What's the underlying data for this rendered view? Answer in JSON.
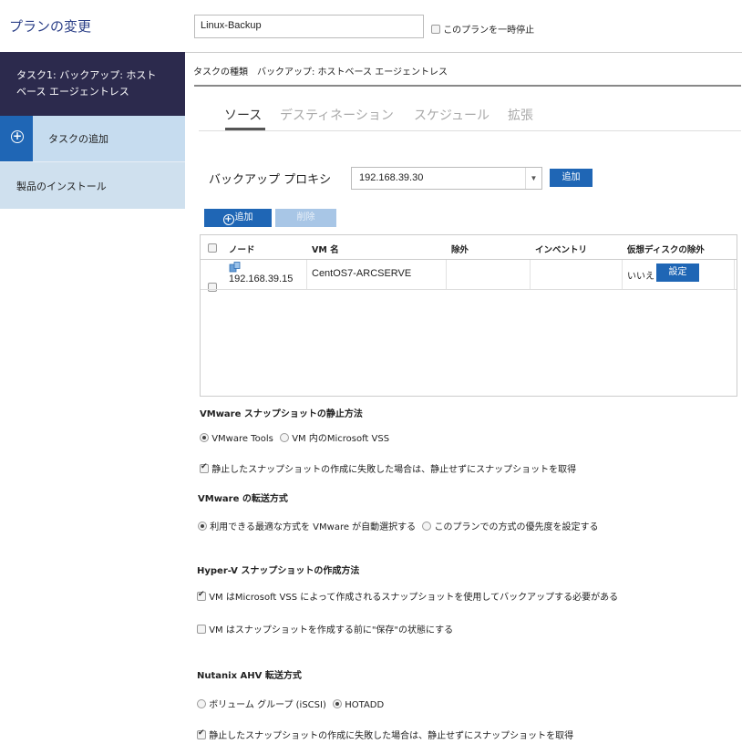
{
  "sidebar": {
    "title": "プランの変更",
    "task1_line1": "タスク1: バックアップ: ホスト",
    "task1_line2": "ベース エージェントレス",
    "add_task": "タスクの追加",
    "install": "製品のインストール"
  },
  "header": {
    "plan_name": "Linux-Backup",
    "suspend_label": "このプランを一時停止",
    "task_type": "タスクの種類　バックアップ: ホストベース エージェントレス"
  },
  "tabs": [
    "ソース",
    "デスティネーション",
    "スケジュール",
    "拡張"
  ],
  "source": {
    "proxy_label": "バックアップ プロキシ",
    "proxy_value": "192.168.39.30",
    "proxy_add": "追加",
    "add_button": "追加",
    "delete_button": "削除",
    "columns": [
      "ノード",
      "VM 名",
      "除外",
      "インベントリ",
      "仮想ディスクの除外"
    ],
    "rows": [
      {
        "node": "192.168.39.15",
        "vm": "CentOS7-ARCSERVE",
        "exclude": "",
        "inventory": "",
        "disk_exclude": "いいえ",
        "setting": "設定"
      }
    ]
  },
  "vmware_snapshot": {
    "title": "VMware スナップショットの静止方法",
    "opt1": "VMware Tools",
    "opt2": "VM 内のMicrosoft VSS",
    "fallback": "静止したスナップショットの作成に失敗した場合は、静止せずにスナップショットを取得"
  },
  "vmware_transfer": {
    "title": "VMware の転送方式",
    "opt1": "利用できる最適な方式を VMware が自動選択する",
    "opt2": "このプランでの方式の優先度を設定する"
  },
  "hyperv": {
    "title": "Hyper-V スナップショットの作成方法",
    "opt1": "VM はMicrosoft VSS によって作成されるスナップショットを使用してバックアップする必要がある",
    "opt2": "VM はスナップショットを作成する前に\"保存\"の状態にする"
  },
  "nutanix": {
    "title": "Nutanix AHV 転送方式",
    "opt1": "ボリューム グループ (iSCSI)",
    "opt2": "HOTADD",
    "fallback": "静止したスナップショットの作成に失敗した場合は、静止せずにスナップショットを取得"
  }
}
